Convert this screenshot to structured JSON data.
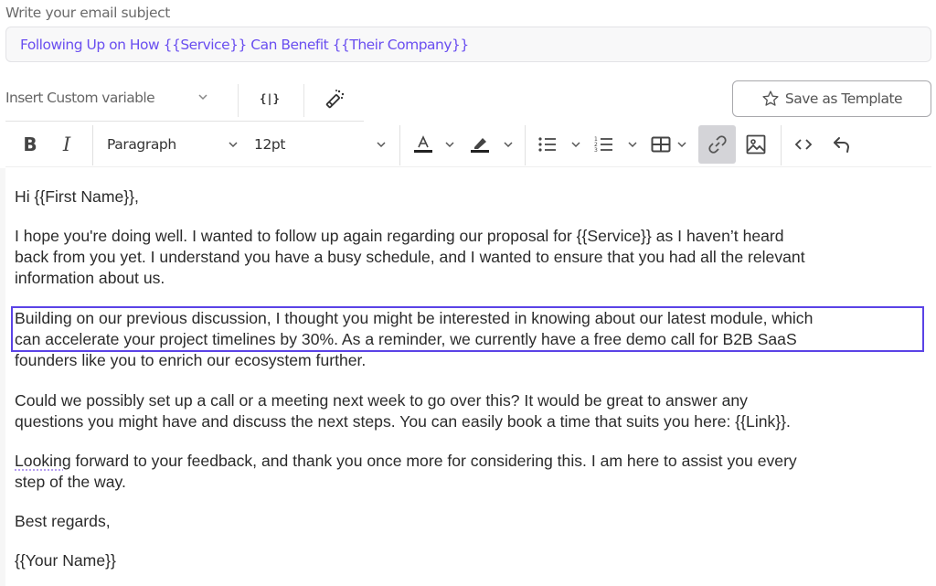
{
  "subject": {
    "label": "Write your email subject",
    "value": "Following Up on How {{Service}} Can Benefit {{Their Company}}",
    "text_color": "#6a4ff0"
  },
  "variable_bar": {
    "insert_variable_label": "Insert Custom variable",
    "curly_button_label": "{|}",
    "magic_icon": "magic-wand-icon",
    "save_template_label": "Save as Template",
    "save_template_icon": "star-outline-icon"
  },
  "toolbar": {
    "bold_label": "B",
    "italic_label": "I",
    "block_format": "Paragraph",
    "font_size": "12pt",
    "icons": [
      "text-color-icon",
      "highlight-color-icon",
      "bullet-list-icon",
      "numbered-list-icon",
      "table-icon",
      "link-icon",
      "image-icon",
      "source-code-icon",
      "undo-icon"
    ],
    "active_tool": "link",
    "active_bg": "#d4d4d8"
  },
  "editor": {
    "selection_color": "#5b43e6",
    "paragraphs": [
      "Hi {{First Name}},",
      "I hope you're doing well. I wanted to follow up again regarding our proposal for {{Service}} as I haven’t heard\nback from you yet. I understand you have a busy schedule, and I wanted to ensure that you had all the relevant\ninformation about us.",
      "Building on our previous discussion, I thought you might be interested in knowing about our latest module, which\ncan accelerate your project timelines by 30%. As a reminder, we currently have a free demo call for B2B SaaS",
      "founders like you to enrich our ecosystem further.",
      "Could we possibly set up a call or a meeting next week to go over this? It would be great to answer any\nquestions you might have and discuss the next steps. You can easily book a time that suits you here: {{Link}}.",
      "forward to your feedback, and thank you once more for considering this. I am here to assist you every\nstep of the way.",
      "Best regards,",
      "{{Your Name}}"
    ],
    "misspelled_word": "Looking"
  }
}
